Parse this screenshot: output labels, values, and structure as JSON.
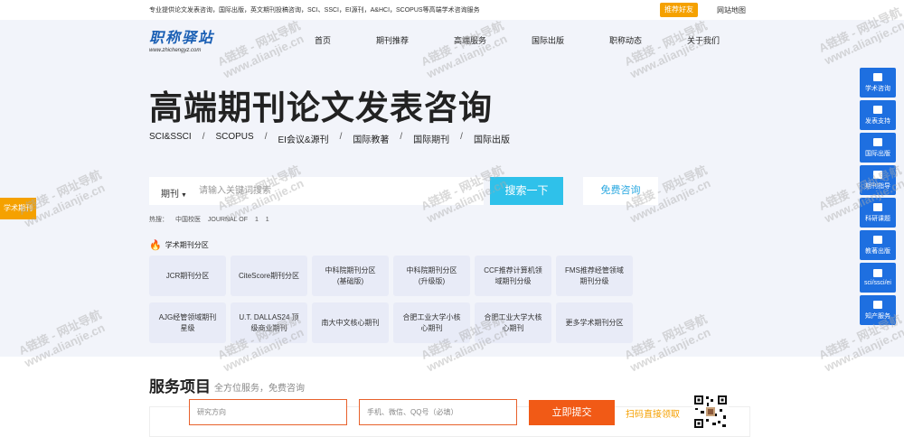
{
  "topbar": {
    "tagline": "专业提供论文发表咨询，国际出版，英文期刊投稿咨询，SCI、SSCI，EI源刊，A&HCI，SCOPUS等高端学术咨询服务",
    "recommend": "推荐好友",
    "sitemap": "网站地图"
  },
  "logo": {
    "title": "职称驿站",
    "url": "www.zhichengyz.com"
  },
  "nav": [
    "首页",
    "期刊推荐",
    "高端服务",
    "国际出版",
    "职称动态",
    "关于我们"
  ],
  "hero": {
    "title": "高端期刊论文发表咨询",
    "categories": [
      "SCI&SSCI",
      "SCOPUS",
      "EI会议&源刊",
      "国际教著",
      "国际期刊",
      "国际出版"
    ],
    "separator": "/"
  },
  "search": {
    "scope": "期刊",
    "placeholder": "请输入关键词搜索",
    "button": "搜索一下",
    "consult": "免费咨询"
  },
  "hot": {
    "label": "热搜：",
    "terms": [
      "中国校医",
      "JOURNAL OF",
      "1",
      "1"
    ]
  },
  "section": {
    "label": "学术期刊分区"
  },
  "grid": [
    "JCR期刊分区",
    "CiteScore期刊分区",
    "中科院期刊分区\n(基础版)",
    "中科院期刊分区\n(升级版)",
    "CCF推荐计算机领\n域期刊分级",
    "FMS推荐经管领域\n期刊分级",
    "AJG经管领域期刊\n星级",
    "U.T. DALLAS24 顶\n级商业期刊",
    "南大中文核心期刊",
    "合肥工业大学小核\n心期刊",
    "合肥工业大学大核\n心期刊",
    "更多学术期刊分区"
  ],
  "services": {
    "title": "服务项目",
    "subtitle": "全方位服务，免费咨询"
  },
  "form": {
    "field1_placeholder": "研究方向",
    "field2_placeholder": "手机、微信、QQ号（必填）",
    "submit": "立即提交",
    "qr_text": "扫码直接领取"
  },
  "left_tab": "学术期刊",
  "sidebar": [
    "学术咨询",
    "发表支持",
    "国际出版",
    "期刊指导",
    "科研课题",
    "教著出版",
    "sci/ssci/ei",
    "知产服务"
  ],
  "watermark": {
    "line1": "A链接 - 网址导航",
    "line2": "www.alianjie.cn"
  },
  "colors": {
    "accent_blue": "#2fc1ea",
    "sidebar_blue": "#1e6fe0",
    "orange": "#f15a16",
    "gold": "#f5a100"
  }
}
